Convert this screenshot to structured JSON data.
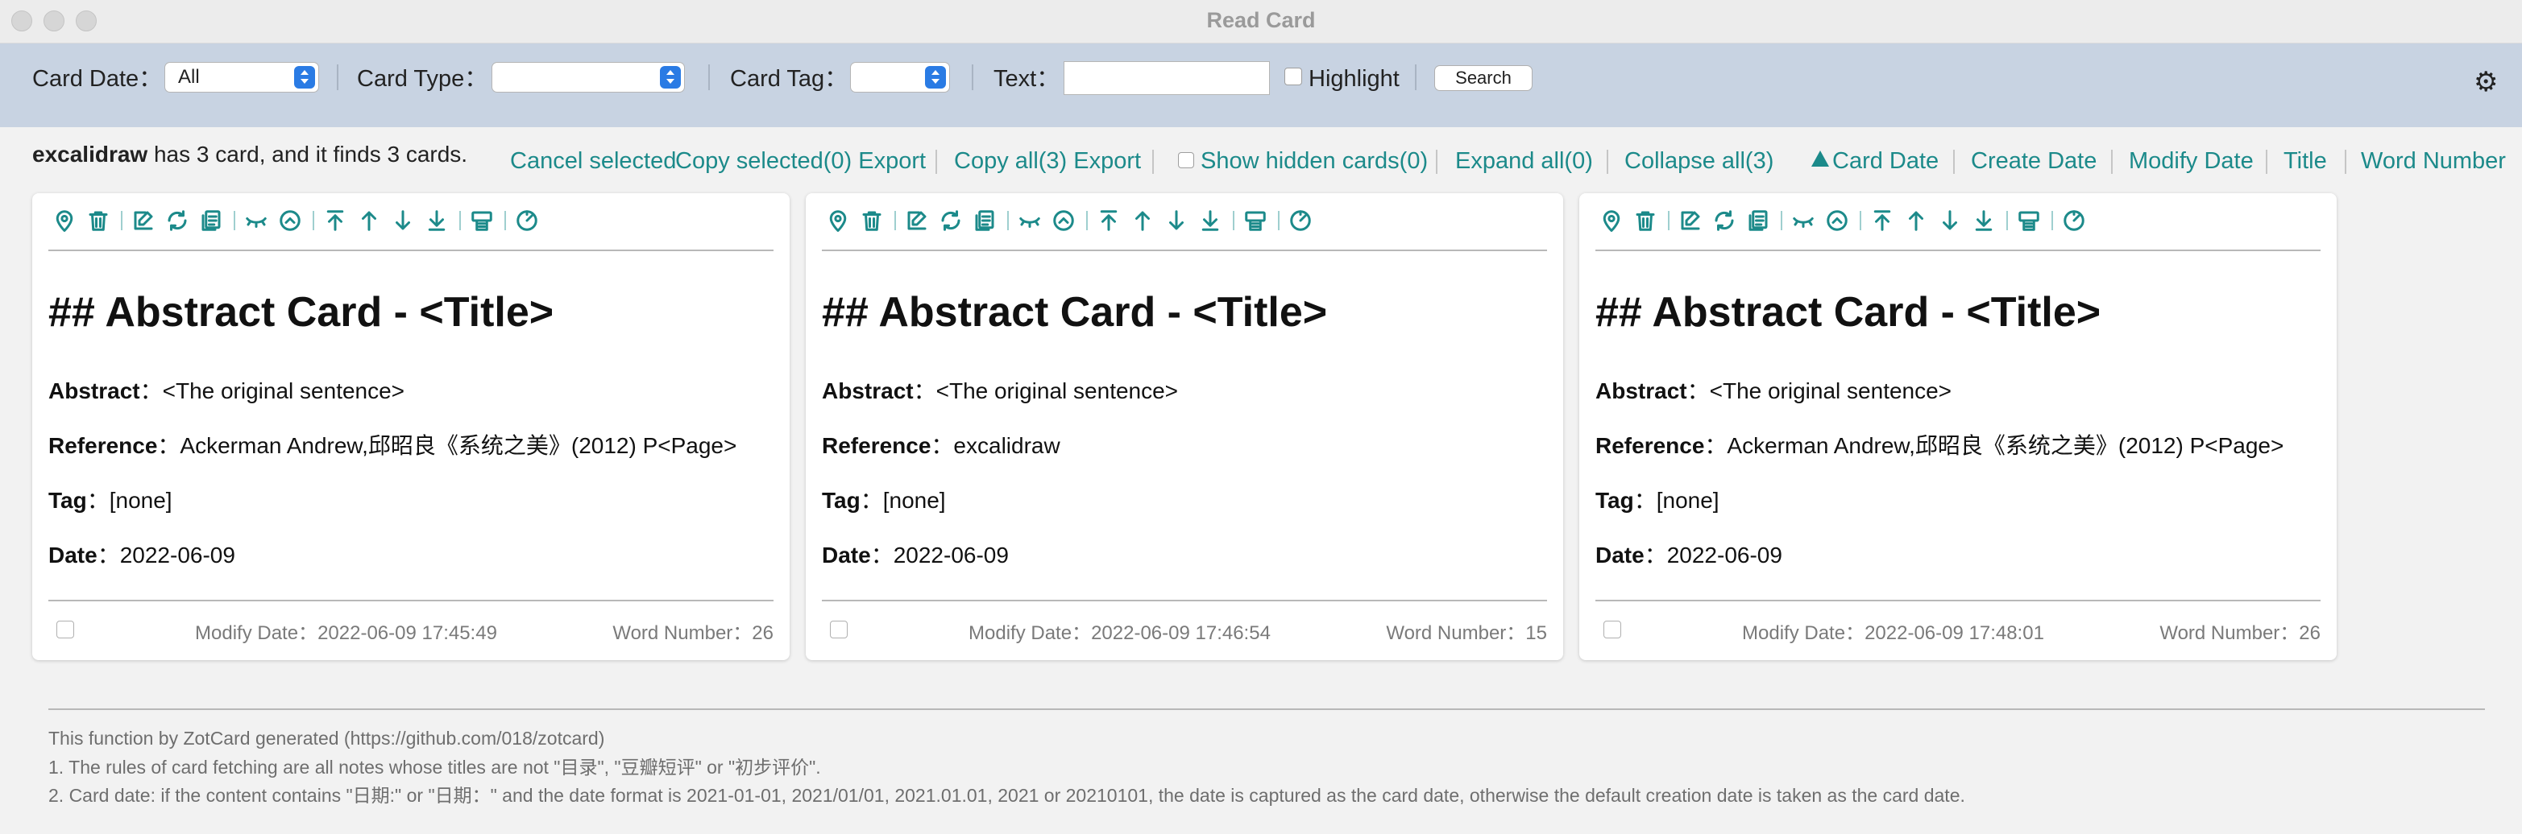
{
  "window": {
    "title": "Read Card"
  },
  "toolbar": {
    "card_date_label": "Card Date：",
    "card_date_value": "All",
    "card_type_label": "Card Type：",
    "card_type_value": "",
    "card_tag_label": "Card Tag：",
    "card_tag_value": "",
    "text_label": "Text：",
    "text_value": "",
    "highlight_label": "Highlight",
    "search_label": "Search"
  },
  "info": {
    "collection": "excalidraw",
    "summary": " has 3 card, and it finds 3 cards."
  },
  "actions": {
    "cancel_selected": "Cancel selected",
    "copy_selected": "Copy selected(0) Export",
    "copy_all": "Copy all(3) Export",
    "show_hidden": "Show hidden cards(0)",
    "expand_all": "Expand all(0)",
    "collapse_all": "Collapse all(3)",
    "sort_card_date": "Card Date",
    "sort_create_date": "Create Date",
    "sort_modify_date": "Modify Date",
    "sort_title": "Title",
    "sort_word_number": "Word Number"
  },
  "card_labels": {
    "abstract": "Abstract",
    "reference": "Reference",
    "tag": "Tag",
    "date": "Date",
    "modify_date": "Modify Date：",
    "word_number": "Word Number："
  },
  "cards": [
    {
      "heading": "## Abstract Card - <Title>",
      "abstract": "<The original sentence>",
      "reference": "Ackerman Andrew,邱昭良《系统之美》(2012) P<Page>",
      "tag": "[none]",
      "date": "2022-06-09",
      "modify_date": "2022-06-09 17:45:49",
      "word_number": "26"
    },
    {
      "heading": "## Abstract Card - <Title>",
      "abstract": "<The original sentence>",
      "reference": "excalidraw",
      "tag": "[none]",
      "date": "2022-06-09",
      "modify_date": "2022-06-09 17:46:54",
      "word_number": "15"
    },
    {
      "heading": "## Abstract Card - <Title>",
      "abstract": "<The original sentence>",
      "reference": "Ackerman Andrew,邱昭良《系统之美》(2012) P<Page>",
      "tag": "[none]",
      "date": "2022-06-09",
      "modify_date": "2022-06-09 17:48:01",
      "word_number": "26"
    }
  ],
  "footer": {
    "line1": "This function by ZotCard generated (https://github.com/018/zotcard)",
    "line2": "1. The rules of card fetching are all notes whose titles are not \"目录\", \"豆瓣短评\" or \"初步评价\".",
    "line3": "2. Card date: if the content contains \"日期:\" or \"日期：\" and the date format is 2021-01-01, 2021/01/01, 2021.01.01, 2021 or 20210101, the date is captured as the card date, otherwise the default creation date is taken as the card date."
  },
  "colors": {
    "accent": "#1c8a8a",
    "toolbar_bg": "#c8d3e2",
    "select_button": "#2a7be4"
  }
}
